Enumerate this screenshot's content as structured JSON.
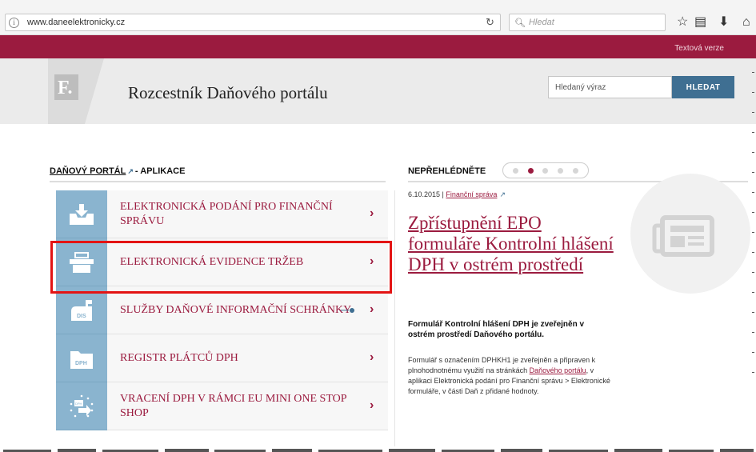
{
  "browser": {
    "url": "www.daneelektronicky.cz",
    "search_placeholder": "Hledat",
    "icons": [
      "info-icon",
      "reload-icon",
      "search-icon",
      "bookmark-star-icon",
      "reading-list-icon",
      "download-icon",
      "home-icon"
    ]
  },
  "topbar": {
    "text_version_link": "Textová verze"
  },
  "header": {
    "logo_letter": "F.",
    "title": "Rozcestník Daňového portálu",
    "search_placeholder": "Hledaný výraz",
    "search_button": "HLEDAT"
  },
  "apps": {
    "breadcrumb_link": "DAŇOVÝ PORTÁL",
    "breadcrumb_rest": "- APLIKACE",
    "items": [
      {
        "label": "ELEKTRONICKÁ PODÁNÍ PRO FINANČNÍ SPRÁVU",
        "icon": "inbox-download-icon"
      },
      {
        "label": "ELEKTRONICKÁ EVIDENCE TRŽEB",
        "icon": "cash-register-icon"
      },
      {
        "label": "SLUŽBY DAŇOVÉ INFORMAČNÍ SCHRÁNKY",
        "icon": "dis-mailbox-icon",
        "has_key": true
      },
      {
        "label": "REGISTR PLÁTCŮ DPH",
        "icon": "dph-folder-icon"
      },
      {
        "label": "VRACENÍ DPH V RÁMCI EU MINI ONE STOP SHOP",
        "icon": "eu-refund-icon"
      }
    ]
  },
  "news": {
    "heading": "NEPŘEHLÉDNĚTE",
    "dots_active_index": 1,
    "date": "6.10.2015 |",
    "source": "Finanční správa",
    "title": "Zpřístupnění EPO formuláře Kontrolní hlášení DPH v ostrém prostředí",
    "lead": "Formulář Kontrolní hlášení DPH je zveřejněn v ostrém prostředí Daňového portálu.",
    "body_1": "Formulář s označením DPHKH1 je zveřejněn a připraven k plnohodnotnému využití na stránkách",
    "body_link": "Daňového portálu",
    "body_2": ", v aplikaci Elektronická podání pro Finanční správu > Elektronické formuláře, v části Daň z přidané hodnoty."
  },
  "colors": {
    "brand_red": "#9b1b3f",
    "brand_blue": "#3f6f92",
    "icon_blue": "#8ab4cf",
    "highlight": "#e31414"
  }
}
